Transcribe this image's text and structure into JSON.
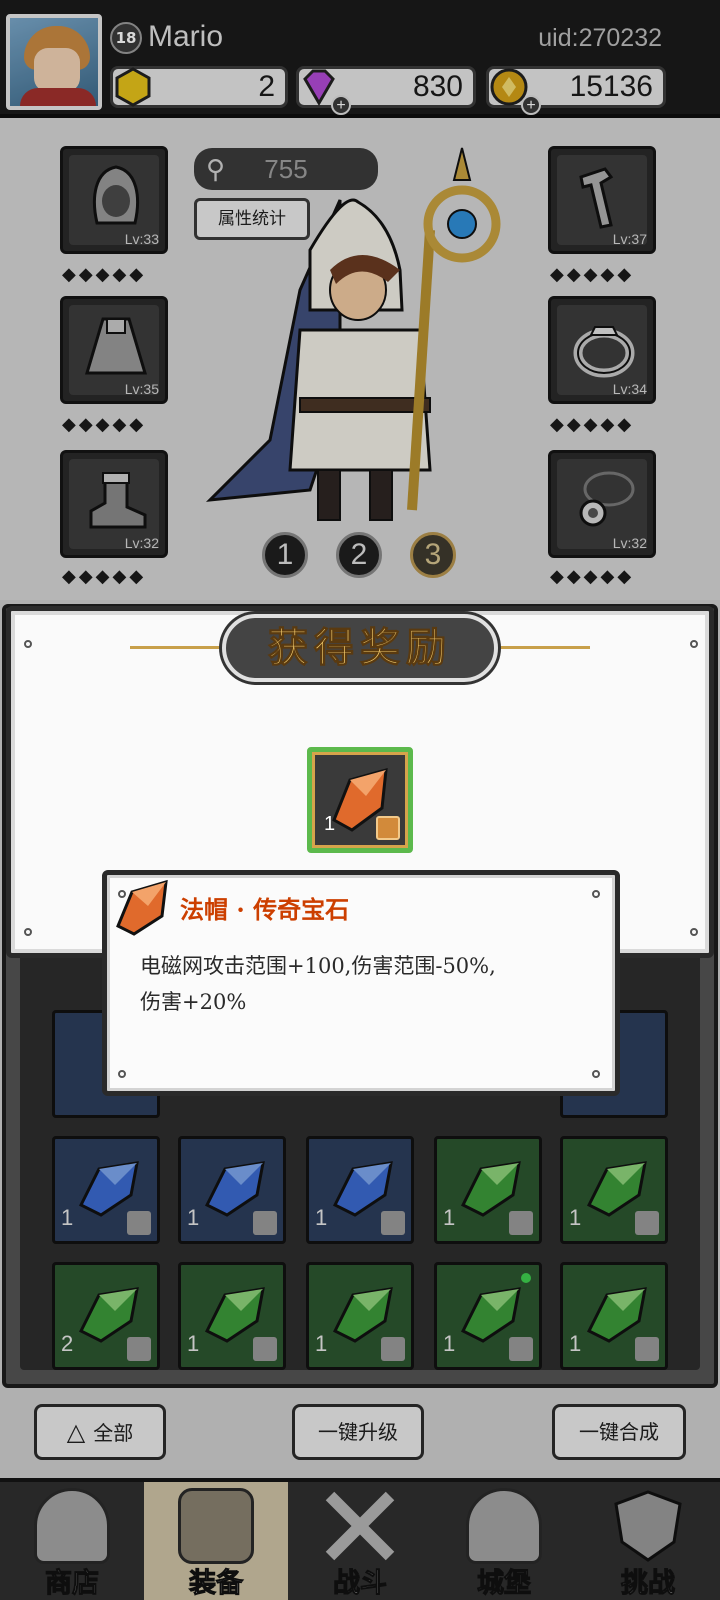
{
  "player": {
    "level": "18",
    "name": "Mario",
    "uid": "uid:270232"
  },
  "currencies": [
    {
      "name": "yellow-gem",
      "value": "2",
      "color": "#e7c21b"
    },
    {
      "name": "purple-diamond",
      "value": "830",
      "color": "#b24bd6"
    },
    {
      "name": "gold-coin",
      "value": "15136",
      "color": "#d4a017"
    }
  ],
  "equipment": {
    "power": "755",
    "attr_button": "属性统计",
    "slots": [
      {
        "name": "hood",
        "level": "Lv:33"
      },
      {
        "name": "cape",
        "level": "Lv:35"
      },
      {
        "name": "boots",
        "level": "Lv:32"
      },
      {
        "name": "staff",
        "level": "Lv:37"
      },
      {
        "name": "ring",
        "level": "Lv:34"
      },
      {
        "name": "amulet",
        "level": "Lv:32"
      }
    ],
    "loadouts": [
      "1",
      "2",
      "3"
    ],
    "active_loadout": "3"
  },
  "inventory": {
    "rows": [
      [
        {
          "color": "blue",
          "count": "1"
        },
        {
          "color": "blue",
          "count": "1"
        },
        {
          "color": "blue",
          "count": "1"
        },
        {
          "color": "green",
          "count": "1"
        },
        {
          "color": "green",
          "count": "1"
        }
      ],
      [
        {
          "color": "green",
          "count": "2"
        },
        {
          "color": "green",
          "count": "1"
        },
        {
          "color": "green",
          "count": "1"
        },
        {
          "color": "green",
          "count": "1"
        },
        {
          "color": "green",
          "count": "1"
        }
      ]
    ]
  },
  "actions": {
    "all": "全部",
    "upgrade": "一键升级",
    "merge": "一键合成"
  },
  "nav": [
    {
      "label": "商店"
    },
    {
      "label": "装备"
    },
    {
      "label": "战斗"
    },
    {
      "label": "城堡"
    },
    {
      "label": "挑战"
    }
  ],
  "reward": {
    "title": "获得奖励",
    "item_count": "1",
    "tooltip_title": "法帽 · 传奇宝石",
    "tooltip_desc_line1": "电磁网攻击范围+100,伤害范围-50%,",
    "tooltip_desc_line2": "伤害+20%"
  }
}
